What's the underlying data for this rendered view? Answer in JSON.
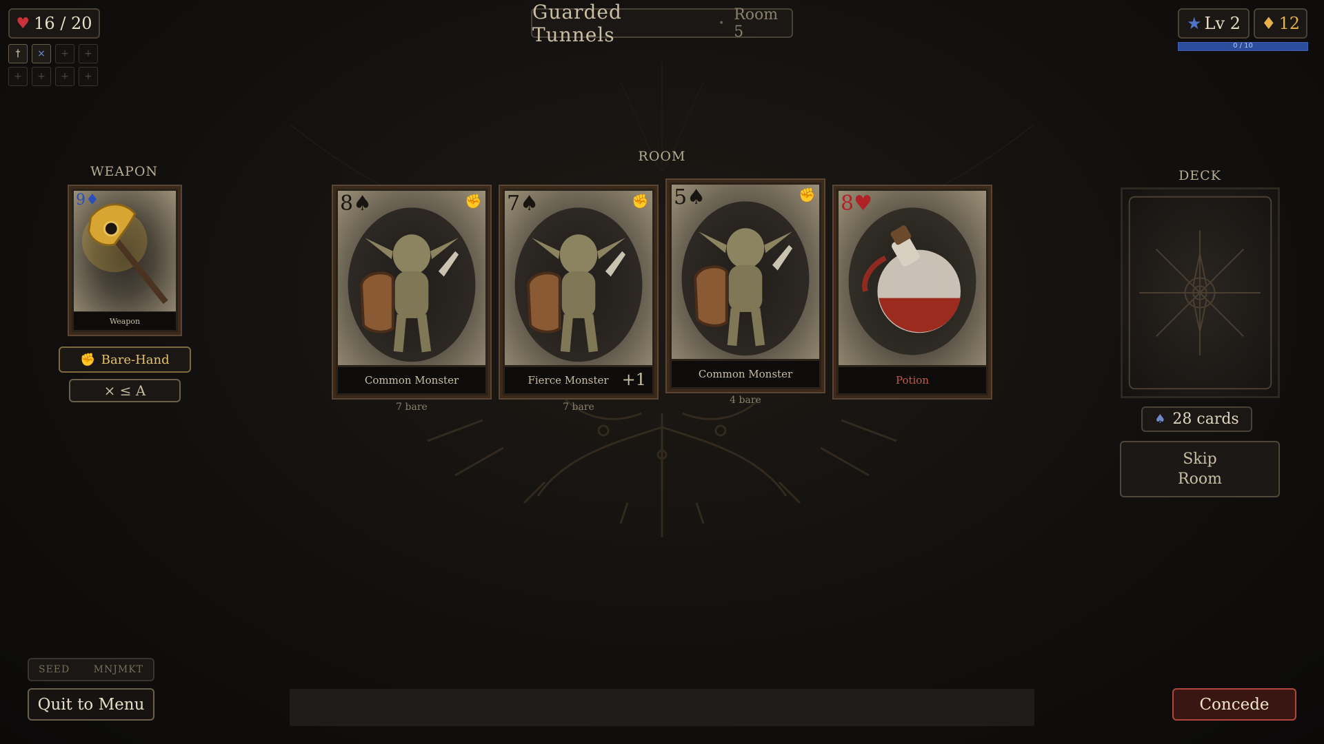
{
  "hud": {
    "health": "16 / 20",
    "level": "Lv 2",
    "gold": "12",
    "xp_text": "0 / 10",
    "xp_fraction": 0,
    "slots_row1": [
      "†",
      "×",
      "+",
      "+"
    ],
    "slots_row2": [
      "+",
      "+",
      "+",
      "+"
    ]
  },
  "header": {
    "title": "Guarded Tunnels",
    "separator": "•",
    "room": "Room 5"
  },
  "weapon": {
    "section_label": "WEAPON",
    "card": {
      "rank": "9",
      "suit": "♦",
      "caption": "Weapon",
      "icon": "golden-axe-icon"
    },
    "mode_button": "Bare-Hand",
    "mode_icon": "fist-icon",
    "rule": "⨯ ≤ A"
  },
  "room": {
    "section_label": "ROOM",
    "cards": [
      {
        "rank": "8",
        "suit": "♠",
        "caption": "Common Monster",
        "subtext": "7 bare",
        "icon": "goblin-icon",
        "bonus": ""
      },
      {
        "rank": "7",
        "suit": "♠",
        "caption": "Fierce Monster",
        "subtext": "7 bare",
        "icon": "goblin-icon",
        "bonus": "+1"
      },
      {
        "rank": "5",
        "suit": "♠",
        "caption": "Common Monster",
        "subtext": "4 bare",
        "icon": "goblin-icon",
        "bonus": ""
      },
      {
        "rank": "8",
        "suit": "♥",
        "caption": "Potion",
        "subtext": "",
        "icon": "potion-icon",
        "bonus": ""
      }
    ]
  },
  "deck": {
    "section_label": "DECK",
    "count": "28 cards",
    "skip_line1": "Skip",
    "skip_line2": "Room"
  },
  "footer": {
    "seed_label": "SEED",
    "seed_value": "MNJMKT",
    "quit": "Quit to Menu",
    "concede": "Concede"
  },
  "colors": {
    "background": "#141210",
    "accent_gold": "#e7b04a",
    "health_red": "#c8323a",
    "xp_blue": "#2c4d9c",
    "concede_border": "#b2483d"
  }
}
